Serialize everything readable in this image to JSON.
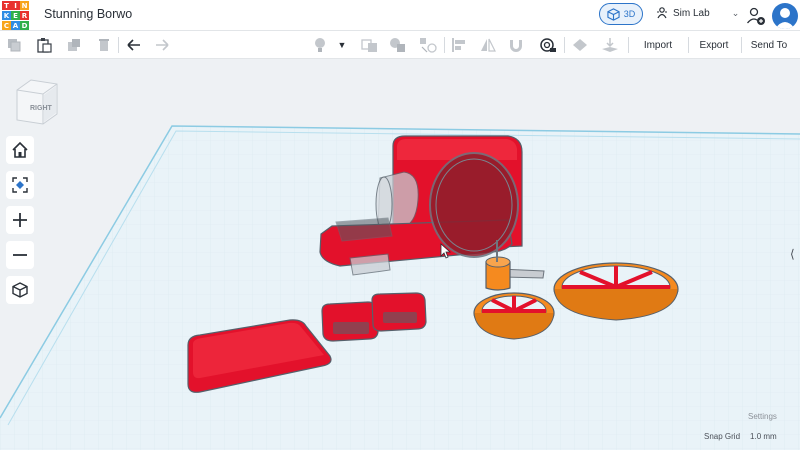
{
  "header": {
    "logo_letters": [
      "T",
      "I",
      "N",
      "K",
      "E",
      "R",
      "C",
      "A",
      "D"
    ],
    "logo_colors": [
      "#e8312f",
      "#e8312f",
      "#f8a51c",
      "#2f8de4",
      "#30b04b",
      "#e8312f",
      "#f8a51c",
      "#2f8de4",
      "#30b04b"
    ],
    "title": "Stunning Borwo",
    "view_mode_label": "3D",
    "sim_lab_label": "Sim Lab"
  },
  "toolbar": {
    "import_label": "Import",
    "export_label": "Export",
    "send_to_label": "Send To"
  },
  "viewcube": {
    "face_label": "RIGHT"
  },
  "footer": {
    "settings_label": "Settings",
    "snap_grid_label": "Snap Grid",
    "snap_grid_value": "1.0 mm"
  },
  "colors": {
    "accent": "#2c74c9",
    "shape_red": "#e3112b",
    "shape_orange": "#f58a1f",
    "workplane": "#e8f2f8",
    "grid_edge": "#7ec4e0"
  }
}
